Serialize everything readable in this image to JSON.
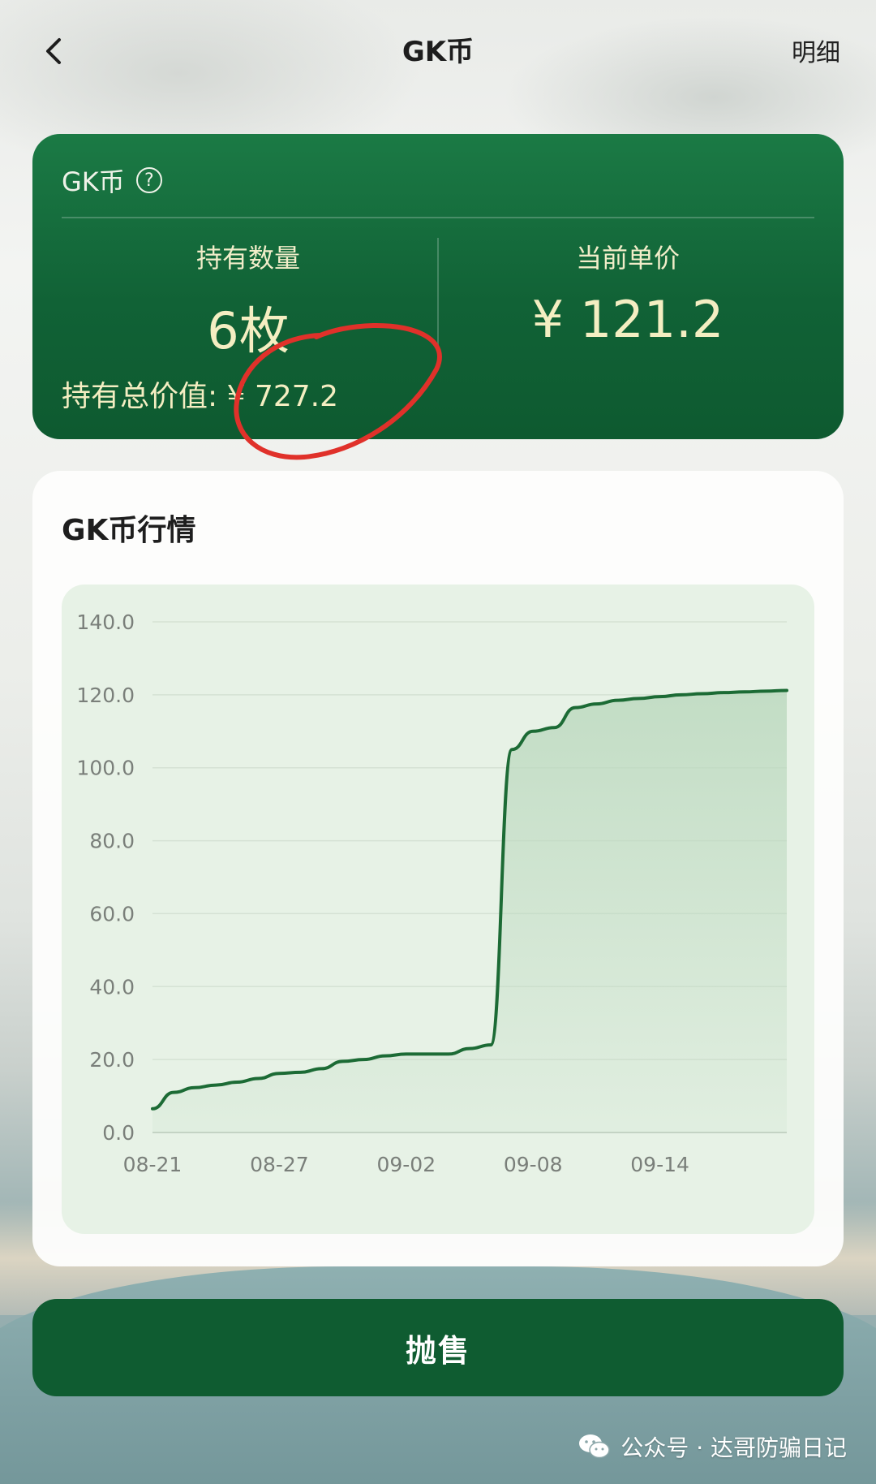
{
  "header": {
    "title": "GK币",
    "detail_label": "明细"
  },
  "summary": {
    "coin_name": "GK币",
    "holding_label": "持有数量",
    "holding_value": "6枚",
    "price_label": "当前单价",
    "price_value": "¥ 121.2",
    "total_label": "持有总价值:",
    "total_value": "¥ 727.2"
  },
  "chart_section": {
    "title": "GK币行情"
  },
  "chart_data": {
    "type": "area",
    "title": "",
    "xlabel": "",
    "ylabel": "",
    "ylim": [
      0,
      140
    ],
    "yticks": [
      "0.0",
      "20.0",
      "40.0",
      "60.0",
      "80.0",
      "100.0",
      "120.0",
      "140.0"
    ],
    "xticks": [
      "08-21",
      "08-27",
      "09-02",
      "09-08",
      "09-14"
    ],
    "grid": true,
    "series": [
      {
        "x": [
          "08-21",
          "08-22",
          "08-23",
          "08-24",
          "08-25",
          "08-26",
          "08-27",
          "08-28",
          "08-29",
          "08-30",
          "08-31",
          "09-01",
          "09-02",
          "09-03",
          "09-04",
          "09-05",
          "09-06",
          "09-07",
          "09-08",
          "09-09",
          "09-10",
          "09-11",
          "09-12",
          "09-13",
          "09-14",
          "09-15",
          "09-16",
          "09-17",
          "09-18",
          "09-19",
          "09-20"
        ],
        "values": [
          6.5,
          11,
          12.3,
          13,
          13.8,
          14.8,
          16.2,
          16.5,
          17.5,
          19.5,
          20,
          21,
          21.5,
          21.5,
          21.5,
          23,
          24,
          105,
          110,
          111,
          116.5,
          117.5,
          118.5,
          119,
          119.5,
          120,
          120.3,
          120.6,
          120.8,
          121,
          121.2
        ]
      }
    ],
    "colors": {
      "line": "#1c6b35",
      "fill": "#bcd9bf"
    }
  },
  "actions": {
    "sell_label": "抛售"
  },
  "watermark": {
    "text": "公众号 · 达哥防骗日记"
  }
}
